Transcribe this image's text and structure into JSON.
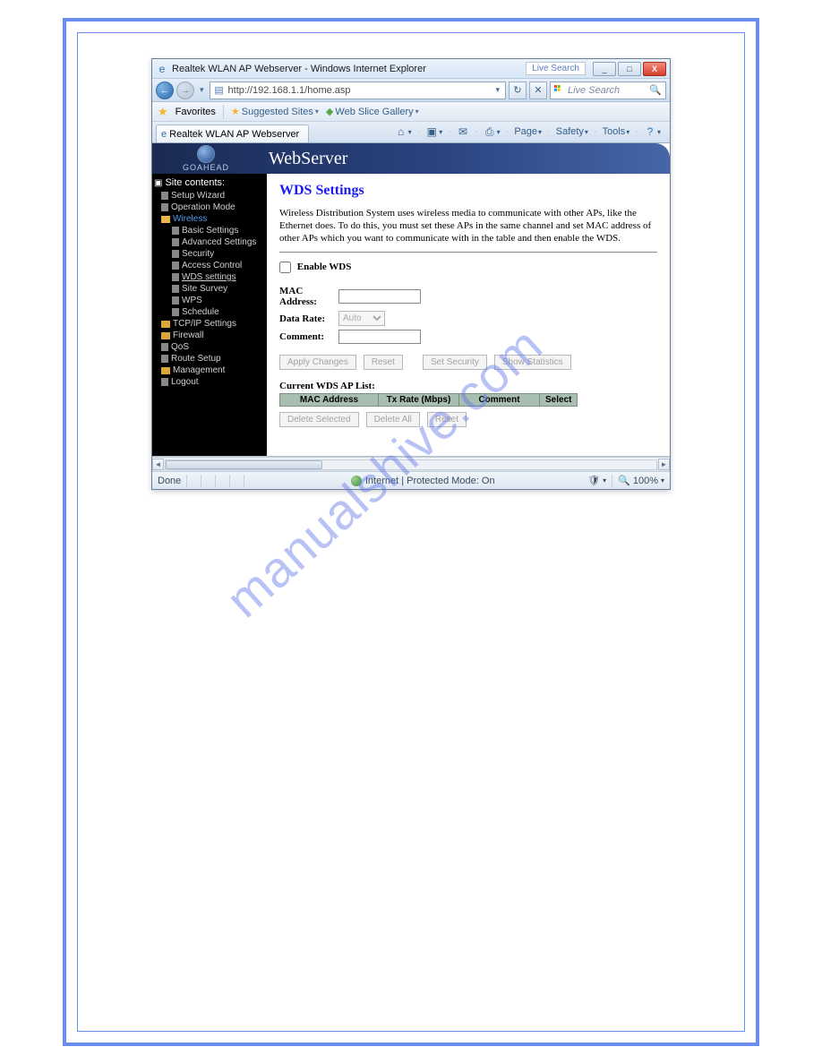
{
  "watermark": "manualshive.com",
  "window": {
    "title": "Realtek WLAN AP Webserver - Windows Internet Explorer",
    "live_search_badge": "Live Search",
    "min": "_",
    "max": "□",
    "close": "X"
  },
  "addr": {
    "url": "http://192.168.1.1/home.asp",
    "search_placeholder": "Live Search",
    "search_icon": "🔍"
  },
  "fav": {
    "label": "Favorites",
    "suggested": "Suggested Sites",
    "webslice": "Web Slice Gallery"
  },
  "tab": {
    "label": "Realtek WLAN AP Webserver"
  },
  "cmd": {
    "page": "Page",
    "safety": "Safety",
    "tools": "Tools"
  },
  "banner": {
    "brand": "GOAHEAD",
    "title": "WebServer"
  },
  "sidebar": {
    "root": "Site contents:",
    "items": [
      {
        "label": "Setup Wizard",
        "type": "page"
      },
      {
        "label": "Operation Mode",
        "type": "page"
      },
      {
        "label": "Wireless",
        "type": "folder-open",
        "active": true
      },
      {
        "label": "Basic Settings",
        "type": "page",
        "sub": true
      },
      {
        "label": "Advanced Settings",
        "type": "page",
        "sub": true
      },
      {
        "label": "Security",
        "type": "page",
        "sub": true
      },
      {
        "label": "Access Control",
        "type": "page",
        "sub": true
      },
      {
        "label": "WDS settings",
        "type": "page",
        "sub": true,
        "selected": true
      },
      {
        "label": "Site Survey",
        "type": "page",
        "sub": true
      },
      {
        "label": "WPS",
        "type": "page",
        "sub": true
      },
      {
        "label": "Schedule",
        "type": "page",
        "sub": true
      },
      {
        "label": "TCP/IP Settings",
        "type": "folder"
      },
      {
        "label": "Firewall",
        "type": "folder"
      },
      {
        "label": "QoS",
        "type": "page"
      },
      {
        "label": "Route Setup",
        "type": "page"
      },
      {
        "label": "Management",
        "type": "folder"
      },
      {
        "label": "Logout",
        "type": "page"
      }
    ]
  },
  "page": {
    "heading": "WDS Settings",
    "desc": "Wireless Distribution System uses wireless media to communicate with other APs, like the Ethernet does. To do this, you must set these APs in the same channel and set MAC address of other APs which you want to communicate with in the table and then enable the WDS.",
    "enable_wds": "Enable WDS",
    "mac_label": "MAC Address:",
    "rate_label": "Data Rate:",
    "rate_value": "Auto",
    "comment_label": "Comment:",
    "btn_apply": "Apply Changes",
    "btn_reset": "Reset",
    "btn_security": "Set Security",
    "btn_stats": "Show Statistics",
    "list_heading": "Current WDS AP List:",
    "th_mac": "MAC Address",
    "th_rate": "Tx Rate (Mbps)",
    "th_comment": "Comment",
    "th_select": "Select",
    "btn_delsel": "Delete Selected",
    "btn_delall": "Delete All",
    "btn_reset2": "Reset"
  },
  "status": {
    "left": "Done",
    "mid": "Internet | Protected Mode: On",
    "zoom": "100%"
  }
}
